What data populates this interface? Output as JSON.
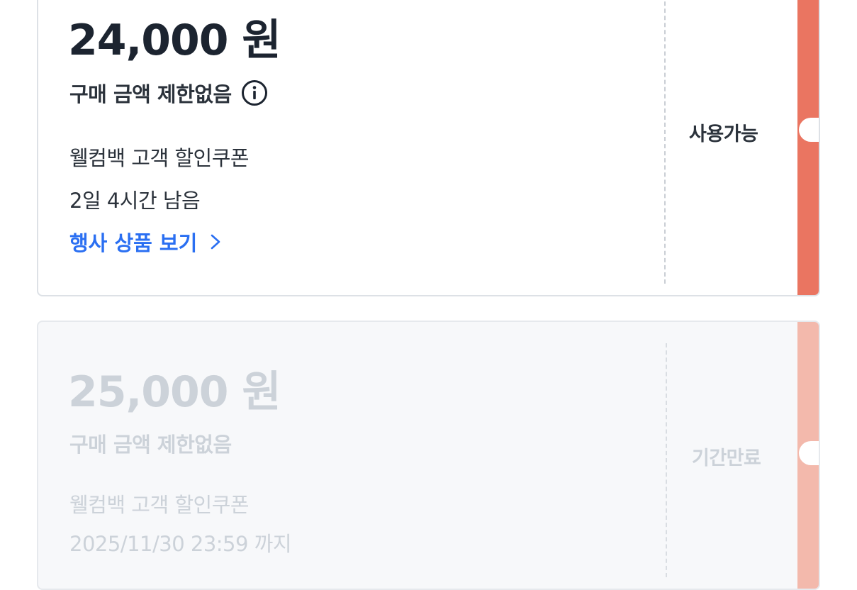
{
  "coupons": [
    {
      "amount": "24,000 원",
      "limit": "구매 금액 제한없음",
      "title": "웰컴백 고객 할인쿠폰",
      "validity": "2일 4시간 남음",
      "link_label": "행사 상품 보기",
      "status": "사용가능",
      "accent_color": "#ea7561",
      "has_info_icon": true
    },
    {
      "amount": "25,000 원",
      "limit": "구매 금액 제한없음",
      "title": "웰컴백 고객 할인쿠폰",
      "validity": "2025/11/30 23:59 까지",
      "status": "기간만료",
      "accent_color": "#f3b9ac",
      "has_info_icon": false
    }
  ],
  "colors": {
    "link": "#2a6ff2",
    "text_primary": "#1c2430",
    "text_disabled": "#ccd2d9"
  }
}
